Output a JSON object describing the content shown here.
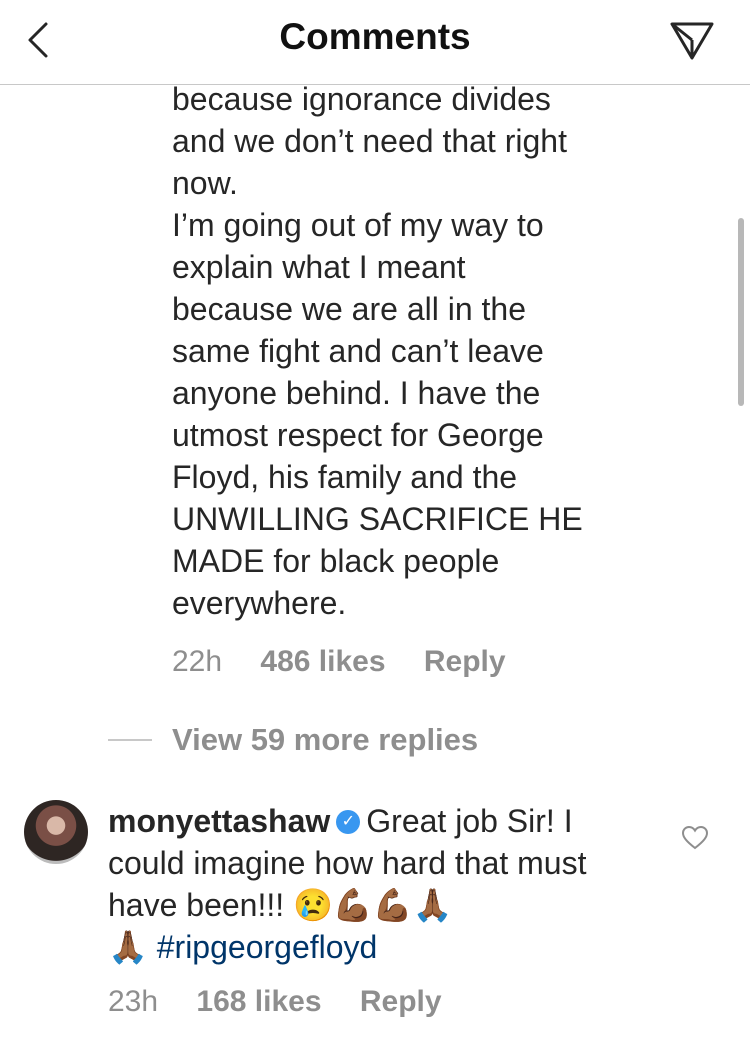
{
  "header": {
    "title": "Comments",
    "back_icon": "chevron-left-icon",
    "share_icon": "paper-plane-icon"
  },
  "reply": {
    "text": "because ignorance divides\nand we don’t need that right\nnow.\nI’m going out of my way to\nexplain what I meant\nbecause we are all in the\nsame fight and can’t leave\nanyone behind. I have the\nutmost respect for George\nFloyd, his family and the\nUNWILLING SACRIFICE HE\nMADE for black people\neverywhere.",
    "time": "22h",
    "likes": "486 likes",
    "reply_label": "Reply"
  },
  "view_replies": {
    "label": "View 59 more replies"
  },
  "comment": {
    "username": "monyettashaw",
    "text_part1": "Great job Sir! I could imagine how hard that must have been!!! ",
    "emojis_line1": "😢💪🏾💪🏾🙏🏾",
    "emoji_line2": "🙏🏾",
    "hashtag": "#ripgeorgefloyd",
    "time": "23h",
    "likes": "168 likes",
    "reply_label": "Reply",
    "like_icon": "heart-outline-icon"
  },
  "colors": {
    "text": "#262626",
    "secondary": "#8e8e8e",
    "verified": "#3897f0",
    "hashtag": "#003569"
  }
}
